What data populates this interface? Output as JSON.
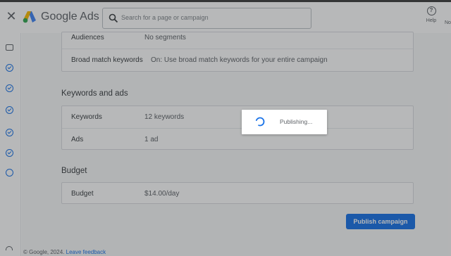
{
  "header": {
    "brand": "Google Ads",
    "search_placeholder": "Search for a page or campaign",
    "help_label": "Help",
    "cut_label": "No"
  },
  "rail": {
    "icons": [
      "campaign-card-icon",
      "step-complete-icon",
      "step-complete-icon",
      "step-complete-icon",
      "step-complete-icon",
      "step-complete-icon",
      "step-current-icon"
    ]
  },
  "top_card": {
    "rows": [
      {
        "label": "Audiences",
        "value": "No segments"
      },
      {
        "label": "Broad match keywords",
        "value": "On: Use broad match keywords for your entire campaign"
      }
    ]
  },
  "keywords_section": {
    "title": "Keywords and ads",
    "rows": [
      {
        "label": "Keywords",
        "value": "12 keywords"
      },
      {
        "label": "Ads",
        "value": "1 ad"
      }
    ]
  },
  "budget_section": {
    "title": "Budget",
    "rows": [
      {
        "label": "Budget",
        "value": "$14.00/day"
      }
    ]
  },
  "actions": {
    "publish_label": "Publish campaign"
  },
  "footer": {
    "copyright": "© Google, 2024.",
    "feedback_link": "Leave feedback"
  },
  "dialog": {
    "text": "Publishing..."
  },
  "colors": {
    "accent": "#1a73e8",
    "scrim": "rgba(32,33,36,0.32)"
  }
}
